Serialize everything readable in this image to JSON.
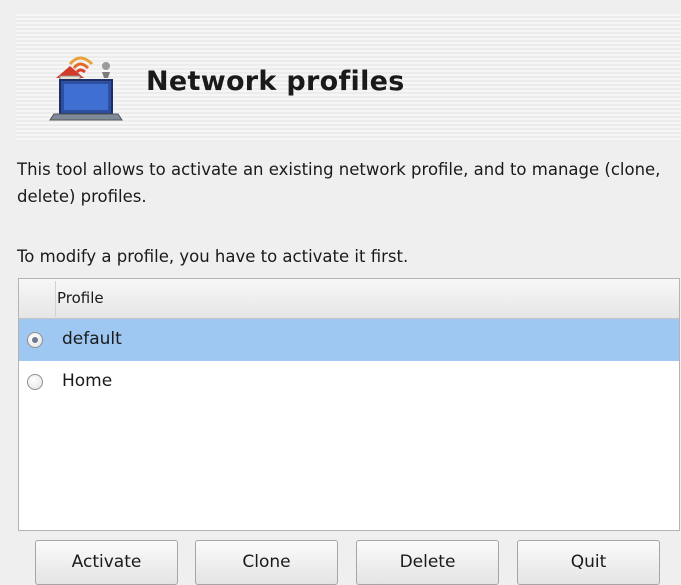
{
  "header": {
    "title": "Network profiles",
    "icon": "network-laptop-icon"
  },
  "description": {
    "line1": "This tool allows to activate an existing network profile, and to manage (clone, delete) profiles.",
    "line2": "To modify a profile, you have to activate it first."
  },
  "profiles": {
    "column_header": "Profile",
    "items": [
      {
        "label": "default",
        "selected": true
      },
      {
        "label": "Home",
        "selected": false
      }
    ]
  },
  "buttons": {
    "activate": "Activate",
    "clone": "Clone",
    "delete": "Delete",
    "quit": "Quit"
  },
  "colors": {
    "selection": "#9ec8f2",
    "background": "#efefef"
  }
}
